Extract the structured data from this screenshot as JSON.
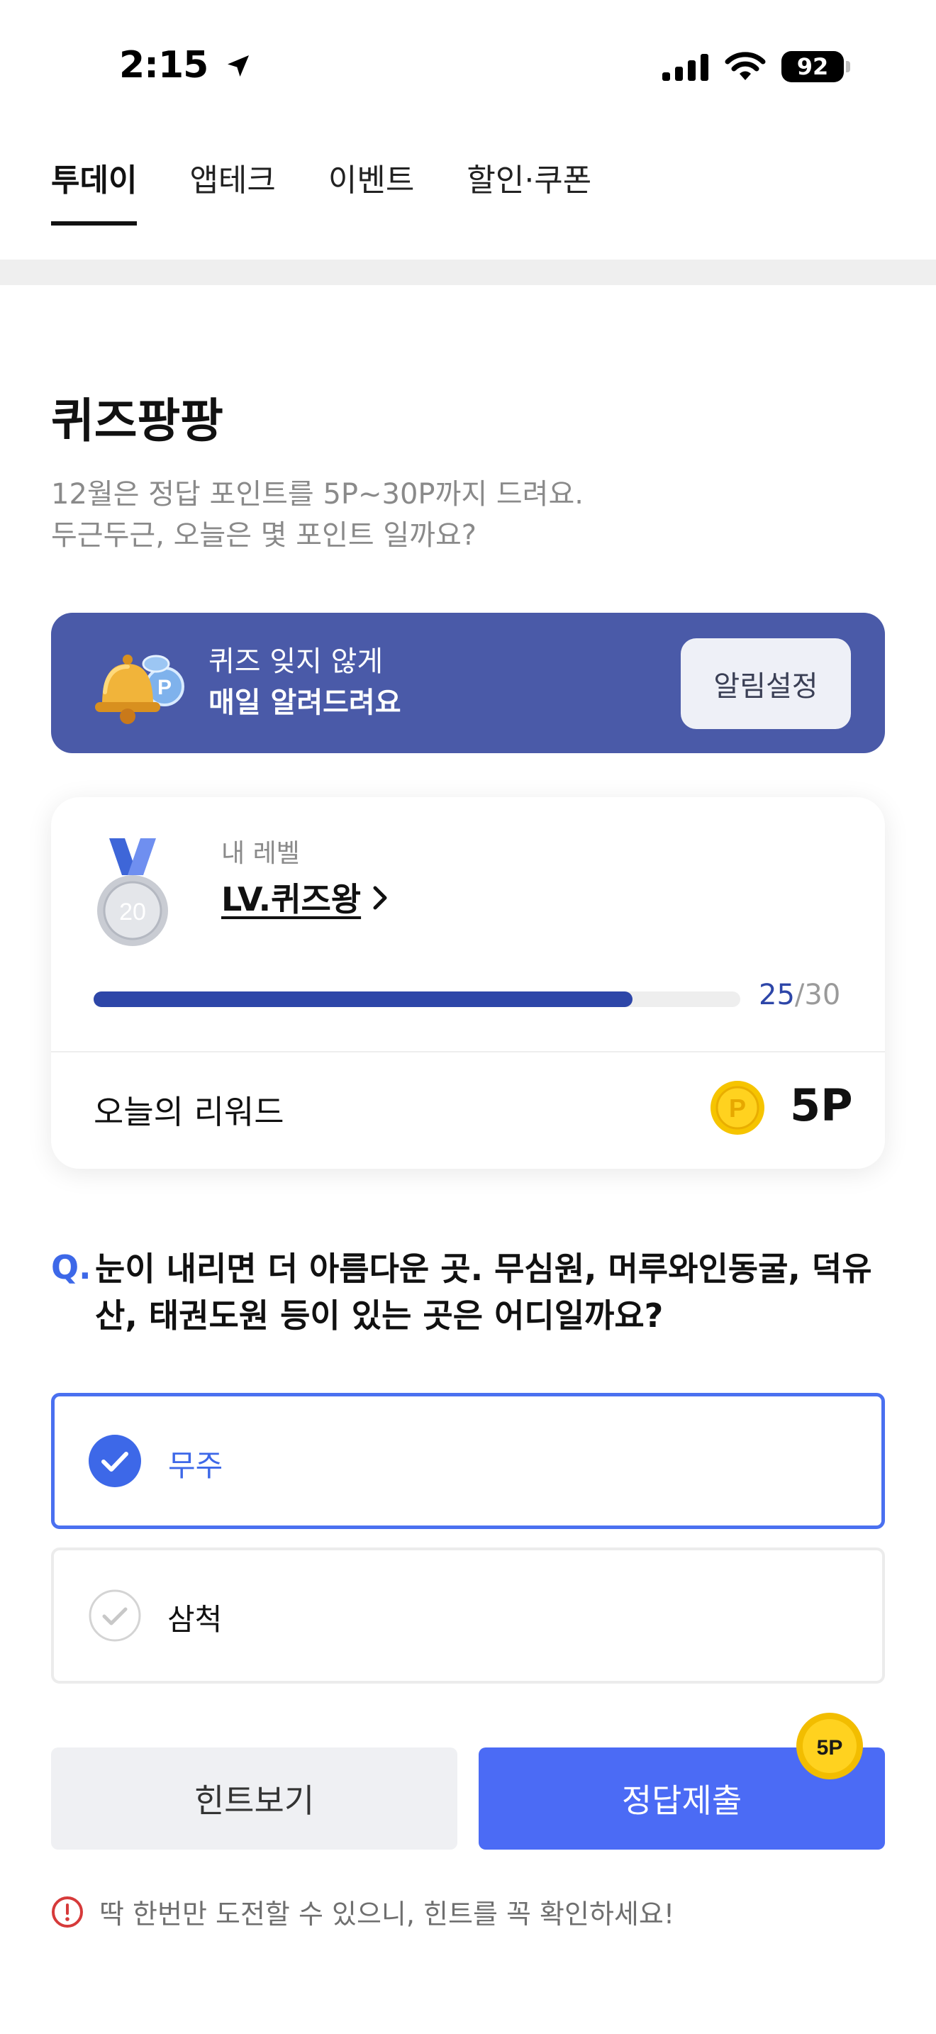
{
  "status_bar": {
    "time": "2:15",
    "battery": "92"
  },
  "tabs": [
    {
      "label": "투데이",
      "active": true
    },
    {
      "label": "앱테크",
      "active": false
    },
    {
      "label": "이벤트",
      "active": false
    },
    {
      "label": "할인·쿠폰",
      "active": false
    }
  ],
  "header": {
    "title": "퀴즈팡팡",
    "subtitle_line1": "12월은 정답 포인트를 5P~30P까지 드려요.",
    "subtitle_line2": "두근두근, 오늘은 몇 포인트 일까요?"
  },
  "banner": {
    "line1": "퀴즈 잊지 않게",
    "line2": "매일 알려드려요",
    "button_label": "알림설정"
  },
  "level_card": {
    "caption": "내 레벨",
    "level_name": "LV.퀴즈왕",
    "medal_number": "20",
    "progress_current": "25",
    "progress_total": "/30",
    "progress_fraction": 0.833,
    "reward_label": "오늘의 리워드",
    "reward_value": "5P"
  },
  "quiz": {
    "q_mark": "Q.",
    "question": "눈이 내리면 더 아름다운 곳. 무심원, 머루와인동굴, 덕유산, 태권도원 등이 있는 곳은 어디일까요?",
    "options": [
      {
        "label": "무주",
        "selected": true
      },
      {
        "label": "삼척",
        "selected": false
      }
    ]
  },
  "actions": {
    "hint_label": "힌트보기",
    "submit_label": "정답제출",
    "badge": "5P"
  },
  "notice": "딱 한번만 도전할 수 있으니, 힌트를 꼭 확인하세요!",
  "colors": {
    "accent": "#4b6bf5",
    "banner": "#4a5aa8",
    "progress": "#2d46a8",
    "selected_border": "#4a70f0",
    "coin": "#f6c400",
    "notice_icon": "#d63a3a"
  }
}
